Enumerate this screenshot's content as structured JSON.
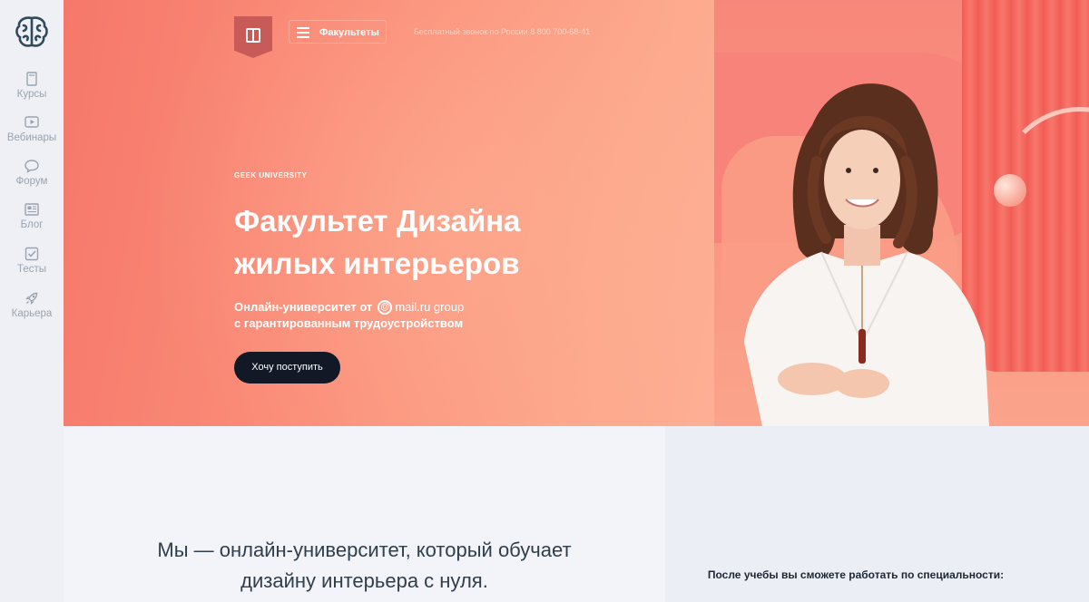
{
  "sidebar": {
    "logo_icon": "brain-icon",
    "items": [
      {
        "label": "Курсы",
        "icon": "book-icon"
      },
      {
        "label": "Вебинары",
        "icon": "play-icon"
      },
      {
        "label": "Форум",
        "icon": "chat-bubble-icon"
      },
      {
        "label": "Блог",
        "icon": "newspaper-icon"
      },
      {
        "label": "Тесты",
        "icon": "checkbox-icon"
      },
      {
        "label": "Карьера",
        "icon": "rocket-icon"
      }
    ]
  },
  "header": {
    "faculties_label": "Факультеты",
    "phone_text": "Бесплатный звонок по России 8 800 700-68-41"
  },
  "hero": {
    "brand": "GEEK UNIVERSITY",
    "title_line1": "Факультет Дизайна",
    "title_line2": "жилых интерьеров",
    "subtitle_line1_prefix": "Онлайн-университет  от",
    "subtitle_line1_brand": "mail.ru group",
    "subtitle_line2": "с гарантированным трудоустройством",
    "cta_label": "Хочу поступить"
  },
  "lower": {
    "intro_line1": "Мы — онлайн-университет, который обучает",
    "intro_line2": "дизайну интерьера с нуля.",
    "after_study_text": "После учебы вы сможете работать по специальности:"
  },
  "colors": {
    "hero_accent": "#f6786a",
    "cta_bg": "#121826",
    "sidebar_bg": "#eef0f6",
    "badge": "#c85a58"
  }
}
